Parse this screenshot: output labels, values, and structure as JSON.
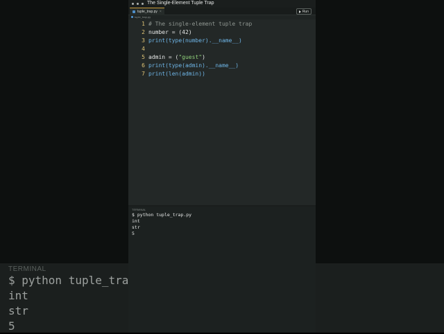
{
  "window": {
    "title": "The Single-Element Tuple Trap"
  },
  "tab": {
    "filename": "tuple_trap.py",
    "close_glyph": "×"
  },
  "breadcrumb": "tuple_trap.py",
  "run_button": {
    "label": "Run"
  },
  "editor": {
    "lines": [
      {
        "num": "1",
        "text": "# The single-element tuple trap"
      },
      {
        "num": "2",
        "text": "number = (42)"
      },
      {
        "num": "3",
        "text": "print(type(number).__name__)"
      },
      {
        "num": "4",
        "text": ""
      },
      {
        "num": "5",
        "text": "admin = (\"guest\")"
      },
      {
        "num": "6",
        "text": "print(type(admin).__name__)"
      },
      {
        "num": "7",
        "text": "print(len(admin))"
      }
    ]
  },
  "terminal": {
    "label": "TERMINAL",
    "lines": [
      "$ python tuple_trap.py",
      "int",
      "str",
      "5"
    ]
  },
  "background_terminal": {
    "label": "TERMINAL",
    "lines": [
      "$ python tuple_trap.",
      "int",
      "str",
      "5"
    ]
  },
  "colors": {
    "accent": "#c99a3a",
    "line_number": "#e0c476",
    "function": "#6fb6e8",
    "string": "#8fd07a",
    "comment": "#8f9691"
  }
}
